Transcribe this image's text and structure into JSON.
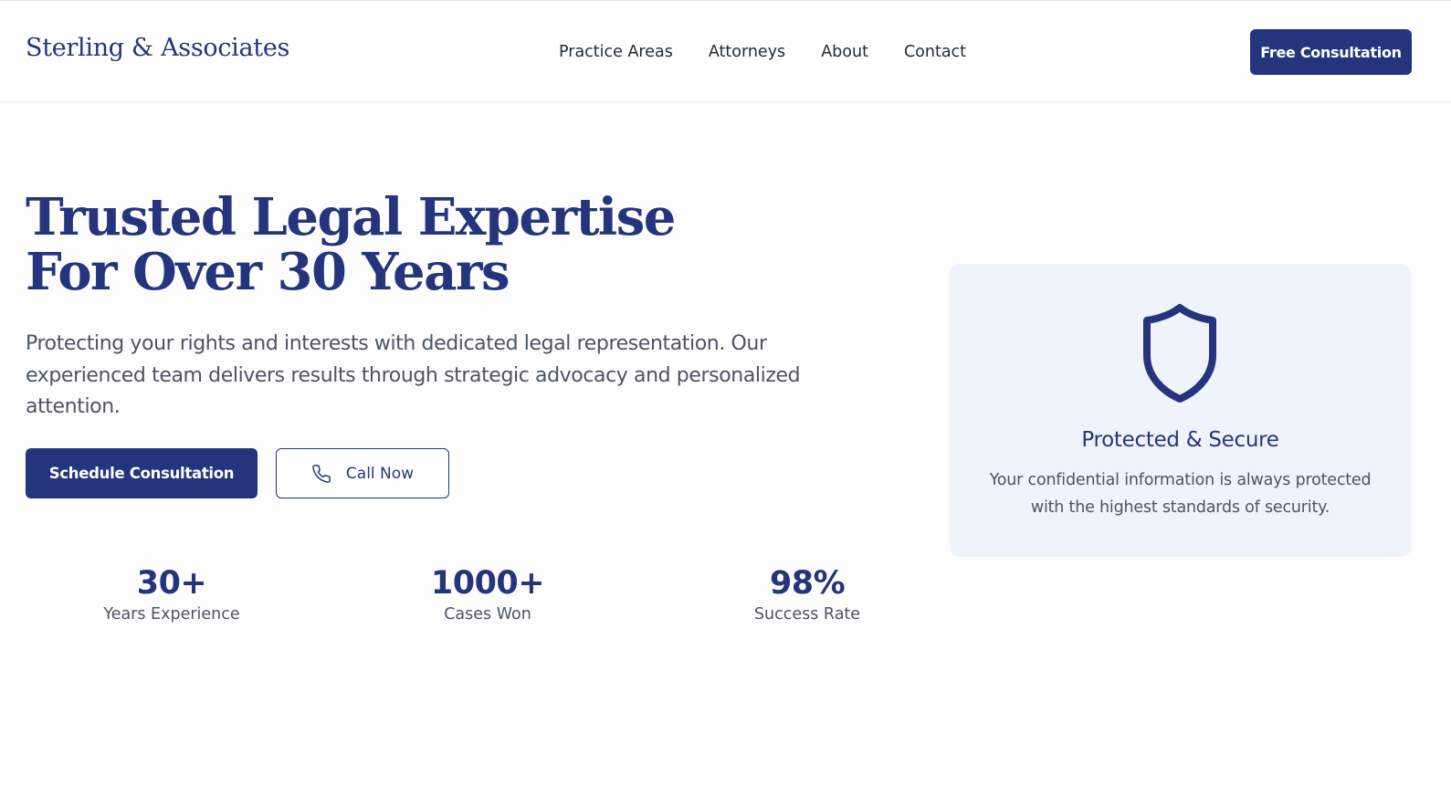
{
  "header": {
    "logo": "Sterling & Associates",
    "nav": [
      "Practice Areas",
      "Attorneys",
      "About",
      "Contact"
    ],
    "cta_label": "Free Consultation"
  },
  "hero": {
    "title_line1": "Trusted Legal Expertise",
    "title_line2": "For Over 30 Years",
    "subtitle": "Protecting your rights and interests with dedicated legal representation. Our experienced team delivers results through strategic advocacy and personalized attention.",
    "primary_button": "Schedule Consultation",
    "secondary_button": "Call Now",
    "secondary_icon": "phone-icon"
  },
  "stats": [
    {
      "value": "30+",
      "label": "Years Experience"
    },
    {
      "value": "1000+",
      "label": "Cases Won"
    },
    {
      "value": "98%",
      "label": "Success Rate"
    }
  ],
  "card": {
    "icon": "shield-icon",
    "title": "Protected & Secure",
    "text": "Your confidential information is always protected with the highest standards of security."
  },
  "colors": {
    "brand": "#24357d",
    "card_bg": "#eff3fc",
    "body_text": "#4b5563"
  }
}
